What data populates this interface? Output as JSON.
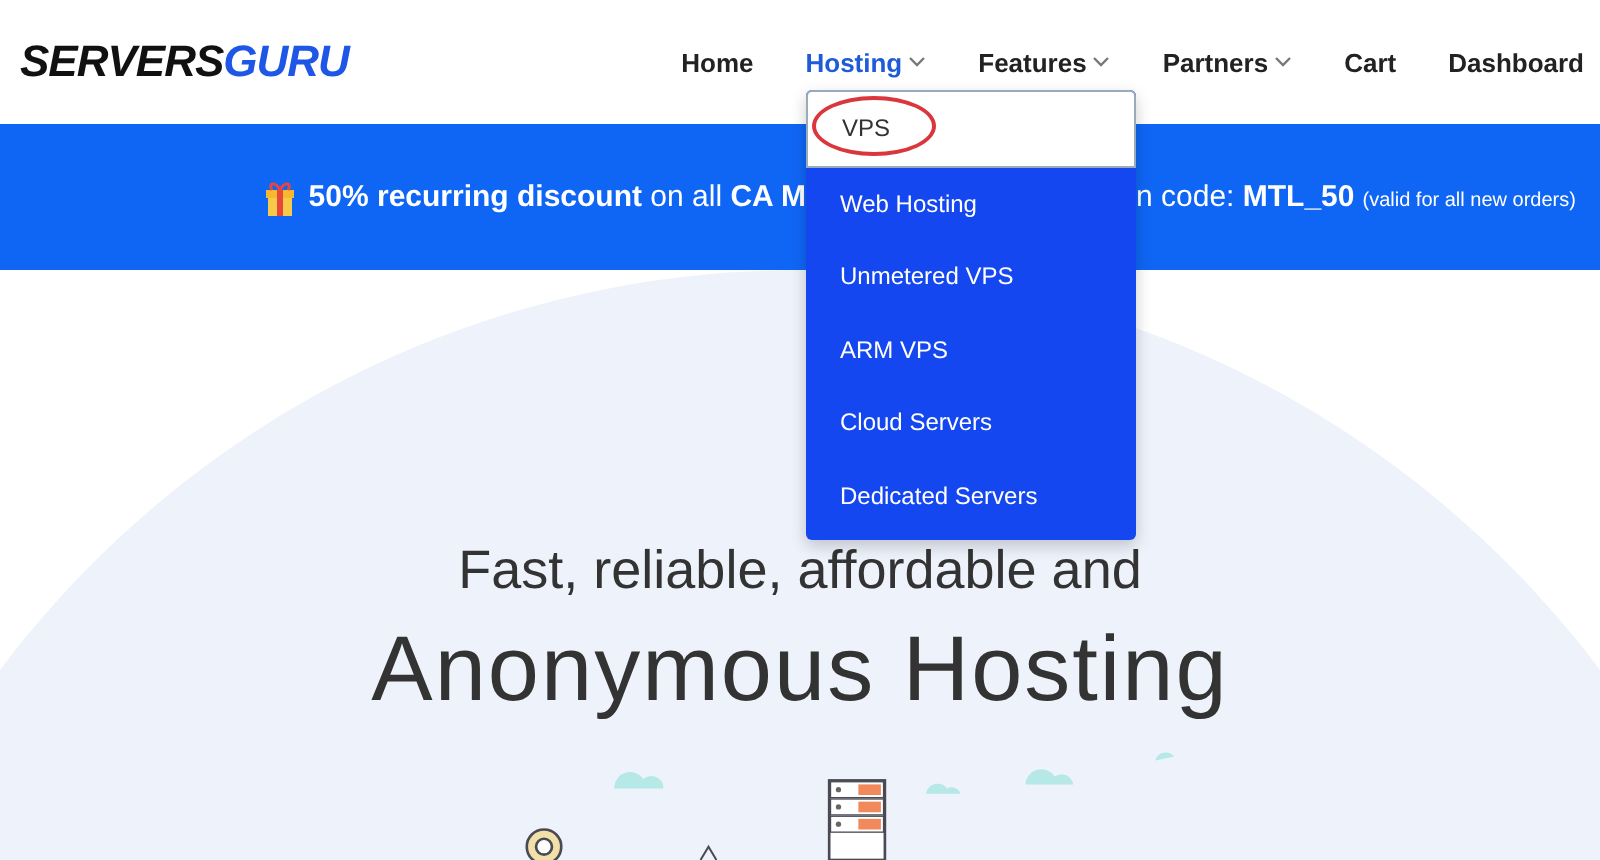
{
  "logo": {
    "part_1": "SERVERS",
    "part_2": "GURU"
  },
  "nav": [
    {
      "label": "Home",
      "selected": false,
      "dropdown": false
    },
    {
      "label": "Hosting",
      "selected": true,
      "dropdown": true
    },
    {
      "label": "Features",
      "selected": false,
      "dropdown": true
    },
    {
      "label": "Partners",
      "selected": false,
      "dropdown": true
    },
    {
      "label": "Cart",
      "selected": false,
      "dropdown": false
    },
    {
      "label": "Dashboard",
      "selected": false,
      "dropdown": false
    }
  ],
  "banner": {
    "text_left": "**50% recurring discount** on all **CA M**",
    "text_right": "n code: **MTL_50**",
    "note": "(valid for all new orders)"
  },
  "dropdown": {
    "items": [
      {
        "label": "VPS",
        "selected": true,
        "circled": true
      },
      {
        "label": "Web Hosting",
        "selected": false,
        "circled": false
      },
      {
        "label": "Unmetered VPS",
        "selected": false,
        "circled": false
      },
      {
        "label": "ARM VPS",
        "selected": false,
        "circled": false
      },
      {
        "label": "Cloud Servers",
        "selected": false,
        "circled": false
      },
      {
        "label": "Dedicated Servers",
        "selected": false,
        "circled": false
      }
    ]
  },
  "hero": {
    "subtitle": "Fast, reliable, affordable and",
    "title": "Anonymous Hosting"
  }
}
